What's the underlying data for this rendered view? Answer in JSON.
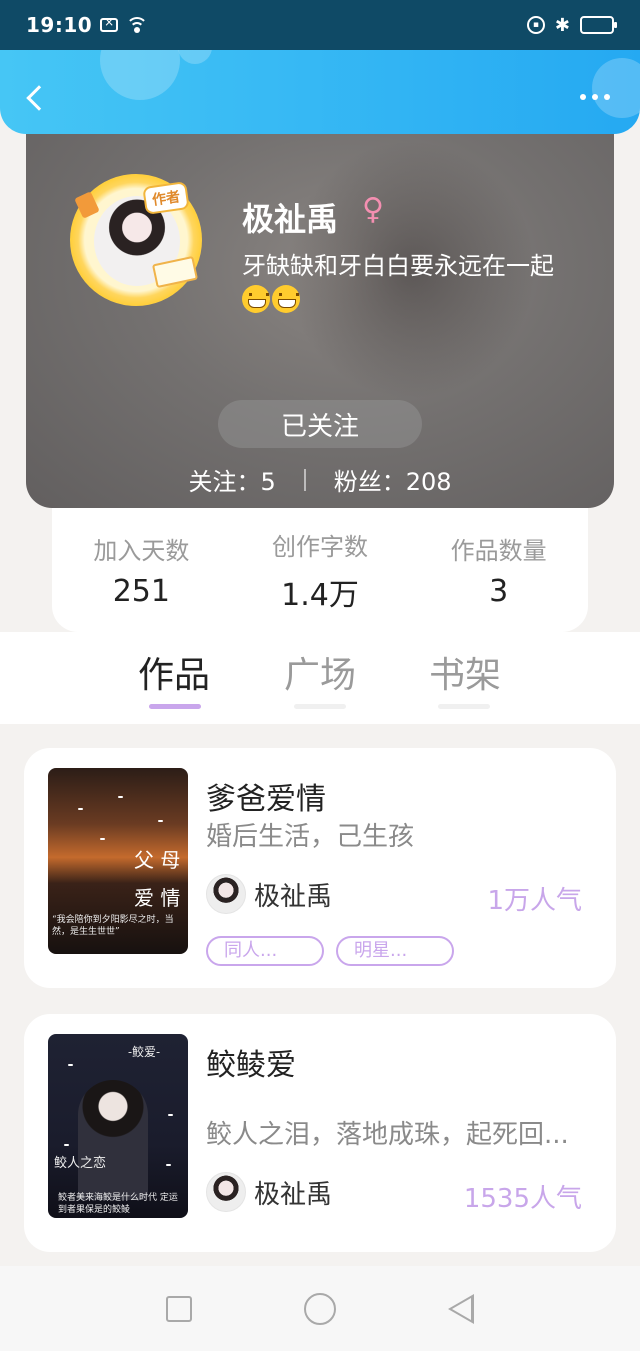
{
  "status_bar": {
    "time": "19:10"
  },
  "header": {
    "back_icon": "chevron-left-icon",
    "more_icon": "more-horizontal-icon"
  },
  "profile": {
    "author_badge": "作者",
    "name": "极祉禹",
    "gender_symbol": "♀",
    "bio": "牙缺缺和牙白白要永远在一起",
    "bio_emojis": [
      "grin-emoji",
      "grin-emoji"
    ],
    "follow_button": "已关注",
    "following": "关注：5",
    "followers": "粉丝：208"
  },
  "stats": [
    {
      "label": "加入天数",
      "value": "251"
    },
    {
      "label": "创作字数",
      "value": "1.4万"
    },
    {
      "label": "作品数量",
      "value": "3"
    }
  ],
  "tabs": [
    {
      "label": "作品",
      "active": true
    },
    {
      "label": "广场",
      "active": false
    },
    {
      "label": "书架",
      "active": false
    }
  ],
  "works": [
    {
      "title": "爹爸爱情",
      "desc": "婚后生活，己生孩",
      "author": "极祉禹",
      "popularity": "1万人气",
      "tags": [
        "同人...",
        "明星..."
      ],
      "cover": {
        "title_a": "父 母",
        "title_b": "爱 情",
        "caption": "“我会陪你到夕阳影尽之时，当然，是生生世世”"
      }
    },
    {
      "title": "鲛鲮爱",
      "desc": "鲛人之泪，落地成珠，起死回...",
      "author": "极祉禹",
      "popularity": "1535人气",
      "tags": [],
      "cover": {
        "title_a": "-鲛爱-",
        "title_b": "鲛人之恋",
        "caption": "鲛者美来海鲛是什么时代 定运到者果保是的鲛鲮"
      }
    }
  ],
  "colors": {
    "header_start": "#46c6f5",
    "header_end": "#25a9f2",
    "accent_purple": "#c9a6ec",
    "status_bar": "#0f4a66"
  }
}
